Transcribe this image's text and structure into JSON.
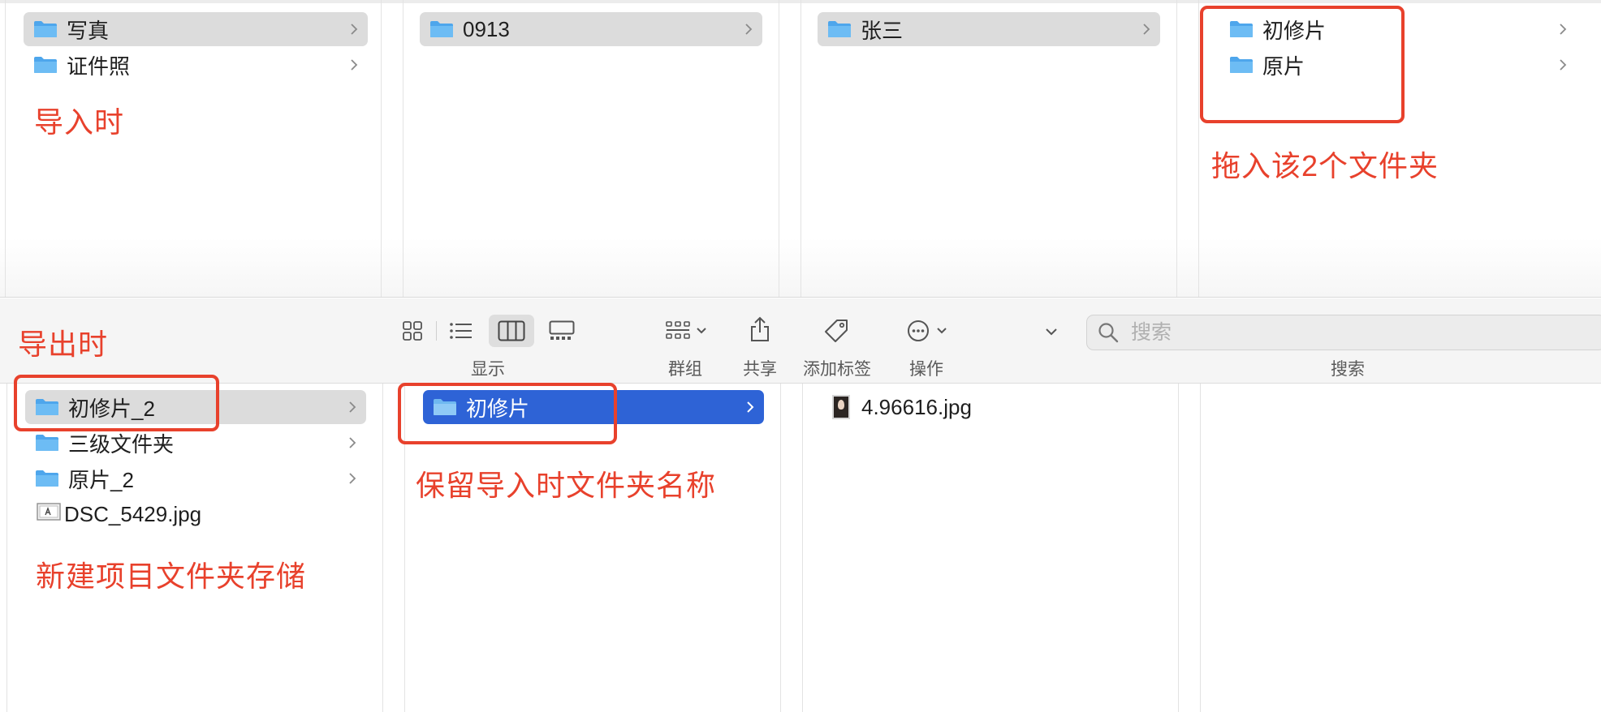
{
  "top": {
    "col1": [
      {
        "label": "写真",
        "selected": true
      },
      {
        "label": "证件照",
        "selected": false
      }
    ],
    "col2": [
      {
        "label": "0913",
        "selected": true
      }
    ],
    "col3": [
      {
        "label": "张三",
        "selected": true
      }
    ],
    "col4": [
      {
        "label": "初修片",
        "selected": false
      },
      {
        "label": "原片",
        "selected": false
      }
    ]
  },
  "annotations": {
    "import_label": "导入时",
    "drag_label": "拖入该2个文件夹",
    "export_label": "导出时",
    "keep_name_label": "保留导入时文件夹名称",
    "new_project_label": "新建项目文件夹存储",
    "color": "#e8412c"
  },
  "toolbar": {
    "view_label": "显示",
    "group_label": "群组",
    "share_label": "共享",
    "tag_label": "添加标签",
    "action_label": "操作",
    "search_label": "搜索",
    "search_placeholder": "搜索"
  },
  "bottom": {
    "col1": [
      {
        "label": "初修片_2",
        "type": "folder",
        "selected": true
      },
      {
        "label": "三级文件夹",
        "type": "folder",
        "selected": false
      },
      {
        "label": "原片_2",
        "type": "folder",
        "selected": false
      },
      {
        "label": "DSC_5429.jpg",
        "type": "file",
        "selected": false
      }
    ],
    "col2": [
      {
        "label": "初修片",
        "type": "folder",
        "selected": true
      }
    ],
    "col3": [
      {
        "label": "4.96616.jpg",
        "type": "image"
      }
    ]
  },
  "colors": {
    "selection_blue": "#2e63d6",
    "selection_gray": "#dcdcdc",
    "folder_blue": "#5fb3f0"
  }
}
